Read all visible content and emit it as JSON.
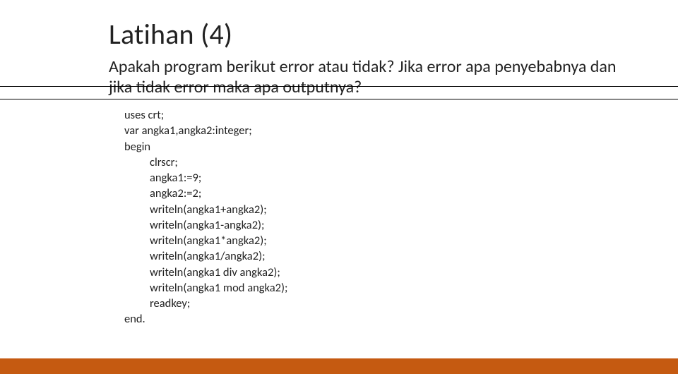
{
  "title": "Latihan (4)",
  "subtitle": "Apakah program berikut error atau tidak? Jika error apa penyebabnya dan jika tidak error maka apa outputnya?",
  "code": {
    "l1": "uses crt;",
    "l2": "var angka1,angka2:integer;",
    "l3": "begin",
    "l4": "clrscr;",
    "l5": "angka1:=9;",
    "l6": "angka2:=2;",
    "l7": "writeln(angka1+angka2);",
    "l8": "writeln(angka1-angka2);",
    "l9": "writeln(angka1*angka2);",
    "l10": "writeln(angka1/angka2);",
    "l11": "writeln(angka1 div angka2);",
    "l12": "writeln(angka1 mod angka2);",
    "l13": "readkey;",
    "l14": "end."
  }
}
